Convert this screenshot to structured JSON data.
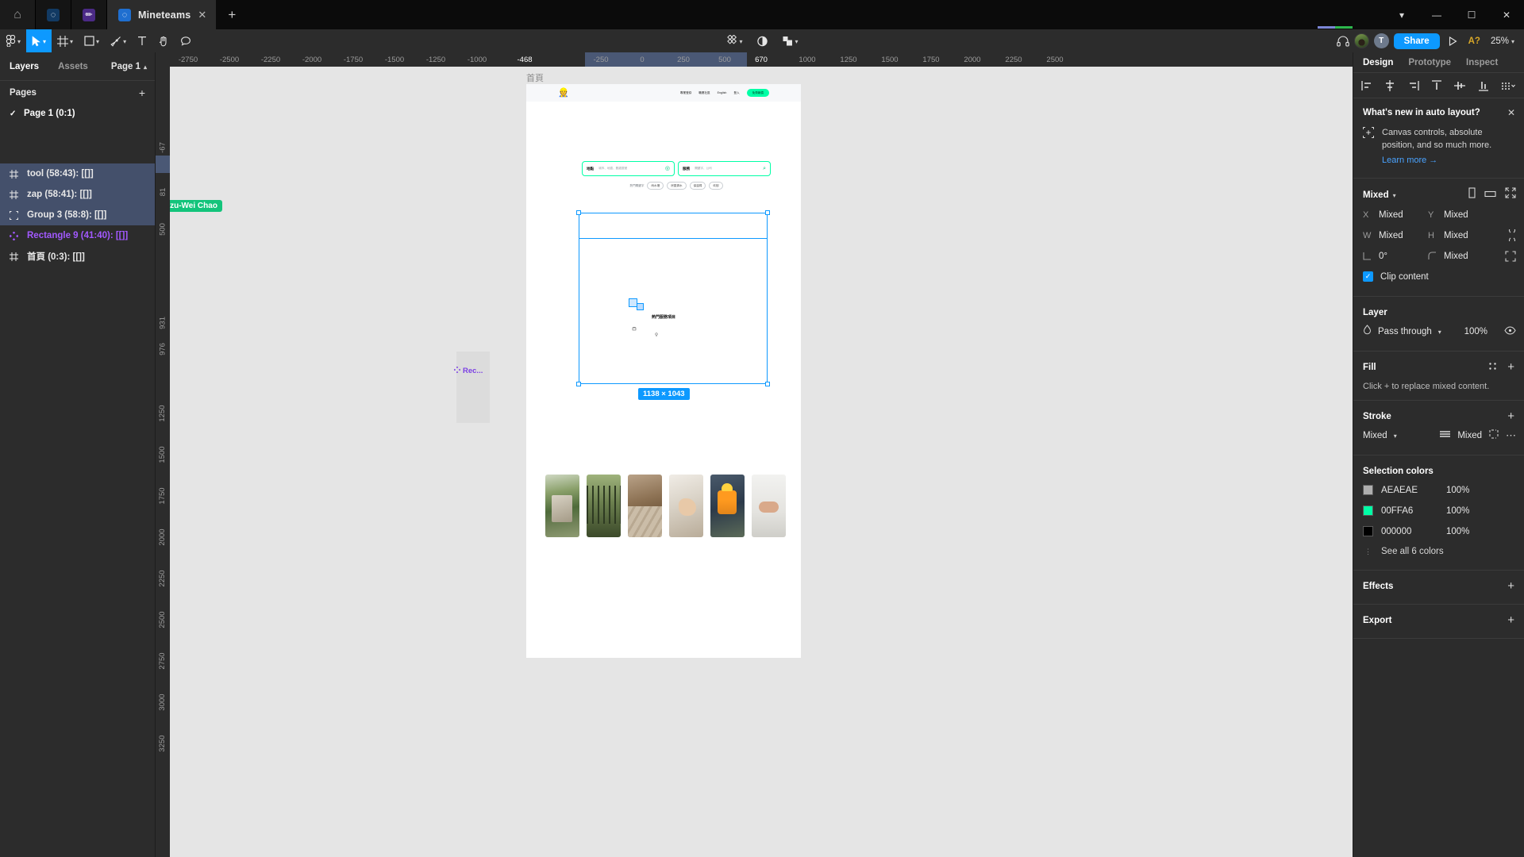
{
  "window": {
    "tabs": [
      {
        "title": "Mineteams",
        "icon": "figma-file-icon"
      }
    ],
    "app_buttons": [
      "home-icon",
      "figma-icon",
      "pen-icon"
    ],
    "new_tab": "+",
    "controls": [
      "chevron-down-icon",
      "minimize-icon",
      "maximize-icon",
      "close-icon"
    ]
  },
  "toolbar": {
    "left_tools": [
      {
        "name": "menu",
        "icon": "figma-logo-icon",
        "caret": true
      },
      {
        "name": "move",
        "icon": "cursor-icon",
        "caret": true,
        "active": true
      },
      {
        "name": "frame",
        "icon": "frame-icon",
        "caret": true
      },
      {
        "name": "shape",
        "icon": "square-icon",
        "caret": true
      },
      {
        "name": "pen",
        "icon": "pen-nib-icon",
        "caret": true
      },
      {
        "name": "text",
        "icon": "text-t-icon",
        "caret": false
      },
      {
        "name": "hand",
        "icon": "hand-icon",
        "caret": false
      },
      {
        "name": "comment",
        "icon": "comment-icon",
        "caret": false
      }
    ],
    "center_tools": [
      {
        "name": "actions",
        "icon": "diamonds-icon",
        "caret": true
      },
      {
        "name": "dev-mode",
        "icon": "half-circle-icon",
        "caret": false
      },
      {
        "name": "plugins",
        "icon": "blocks-icon",
        "caret": true
      }
    ],
    "right": {
      "headphones": "headphones-icon",
      "avatars": [
        "photo-avatar",
        "T"
      ],
      "share_label": "Share",
      "present": "play-icon",
      "badge": "A?",
      "zoom": "25%"
    }
  },
  "left_panel": {
    "tabs": [
      {
        "label": "Layers",
        "active": true
      },
      {
        "label": "Assets",
        "active": false
      }
    ],
    "page_selector": "Page 1",
    "pages_header": "Pages",
    "pages": [
      {
        "label": "Page 1 (0:1)",
        "checked": true
      }
    ],
    "layers": [
      {
        "label": "tool (58:43): [[]]",
        "icon": "frame-icon",
        "selected": true,
        "color": "default"
      },
      {
        "label": "zap (58:41): [[]]",
        "icon": "frame-icon",
        "selected": true,
        "color": "default"
      },
      {
        "label": "Group 3 (58:8): [[]]",
        "icon": "group-icon",
        "selected": true,
        "color": "default"
      },
      {
        "label": "Rectangle 9 (41:40): [[]]",
        "icon": "component-icon",
        "selected": false,
        "color": "purple"
      },
      {
        "label": "首頁 (0:3): [[]]",
        "icon": "frame-icon",
        "selected": false,
        "color": "default"
      }
    ]
  },
  "right_panel": {
    "tabs": [
      {
        "label": "Design",
        "active": true
      },
      {
        "label": "Prototype",
        "active": false
      },
      {
        "label": "Inspect",
        "active": false
      }
    ],
    "align_icons": [
      "align-left-icon",
      "align-horizontal-center-icon",
      "align-right-icon",
      "align-top-icon",
      "align-vertical-center-icon",
      "align-bottom-icon",
      "more-align-icon"
    ],
    "whats_new": {
      "title": "What's new in auto layout?",
      "body": "Canvas controls, absolute position, and so much more.",
      "link": "Learn more →",
      "icon": "absolute-position-icon",
      "close": "close-icon"
    },
    "transform": {
      "preset_label": "Mixed",
      "icons": [
        "vertical-resize-icon",
        "horizontal-resize-icon",
        "collapse-icon"
      ],
      "x_key": "X",
      "x_value": "Mixed",
      "y_key": "Y",
      "y_value": "Mixed",
      "w_key": "W",
      "w_value": "Mixed",
      "h_key": "H",
      "h_value": "Mixed",
      "rotation_value": "0°",
      "corner_value": "Mixed",
      "clip_content_label": "Clip content",
      "clip_content_checked": true
    },
    "layer": {
      "title": "Layer",
      "blend_mode": "Pass through",
      "opacity": "100%",
      "visibility_icon": "eye-icon"
    },
    "fill": {
      "title": "Fill",
      "note": "Click + to replace mixed content.",
      "style_icon": "style-icon",
      "add_icon": "plus-icon"
    },
    "stroke": {
      "title": "Stroke",
      "value": "Mixed",
      "weight": "Mixed",
      "align_icon": "stroke-align-icon",
      "more_icon": "ellipsis-icon",
      "add_icon": "plus-icon"
    },
    "selection_colors": {
      "title": "Selection colors",
      "items": [
        {
          "hex": "AEAEAE",
          "opacity": "100%",
          "swatch": "#AEAEAE"
        },
        {
          "hex": "00FFA6",
          "opacity": "100%",
          "swatch": "#00FFA6"
        },
        {
          "hex": "000000",
          "opacity": "100%",
          "swatch": "#000000"
        }
      ],
      "see_all": "See all 6 colors"
    },
    "effects": {
      "title": "Effects",
      "add_icon": "plus-icon"
    },
    "export": {
      "title": "Export",
      "add_icon": "plus-icon"
    }
  },
  "canvas": {
    "ruler_h": [
      "-2750",
      "-2500",
      "-2250",
      "-2000",
      "-1750",
      "-1500",
      "-1250",
      "-1000",
      "-468",
      "-250",
      "0",
      "250",
      "500",
      "670",
      "1000",
      "1250",
      "1500",
      "1750",
      "2000",
      "2250",
      "2500"
    ],
    "ruler_v": [
      "-67",
      "81",
      "500",
      "931",
      "976",
      "1250",
      "1500",
      "1750",
      "2000",
      "2250",
      "2500",
      "2750",
      "3000",
      "3250"
    ],
    "frame_label": "首頁",
    "selection_size": "1138 × 1043",
    "cursor_label": "Tzu-Wei Chao",
    "rect_label": "Rec...",
    "artboard": {
      "nav": {
        "logo": "worker-avatar-icon",
        "links": [
          "專業登錄",
          "職業社區",
          "English",
          "登入"
        ],
        "cta": "免費報價"
      },
      "search": {
        "location_label": "地點",
        "location_placeholder": "城市、地區、郵遞區號",
        "location_icon": "location-pin-icon",
        "service_label": "服務",
        "service_placeholder": "關鍵字、公司",
        "service_icon": "search-icon",
        "hot_label": "熱門關鍵字",
        "hot_tags": [
          "雨水槽",
          "房屋漏水",
          "保溫棉",
          "砍樹"
        ]
      },
      "hot_services_title": "熱門服務項目",
      "photos": [
        "house-garden-photo",
        "green-fence-photo",
        "paving-stone-photo",
        "painting-hand-photo",
        "worker-roof-photo",
        "plumbing-hand-photo"
      ]
    }
  }
}
